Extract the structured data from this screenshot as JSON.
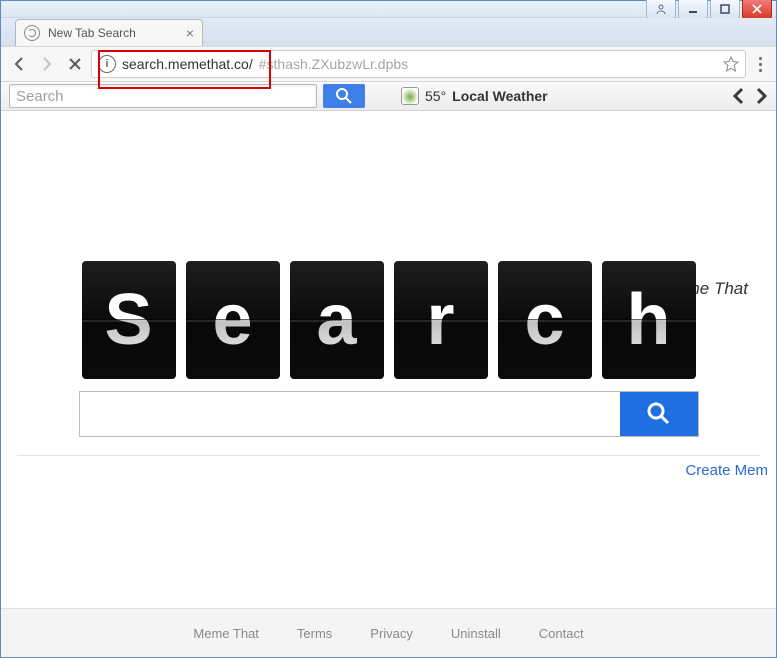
{
  "window": {
    "tab_title": "New Tab Search"
  },
  "toolbar": {
    "url_host": "search.memethat.co/",
    "url_rest": "#sthash.ZXubzwLr.dpbs"
  },
  "ext": {
    "search_placeholder": "Search",
    "weather_temp": "55°",
    "weather_label": "Local Weather"
  },
  "page": {
    "brand": "Meme That",
    "flip_letters": [
      "S",
      "e",
      "a",
      "r",
      "c",
      "h"
    ],
    "search_value": "",
    "create_link": "Create Mem"
  },
  "footer": {
    "links": [
      "Meme That",
      "Terms",
      "Privacy",
      "Uninstall",
      "Contact"
    ]
  }
}
